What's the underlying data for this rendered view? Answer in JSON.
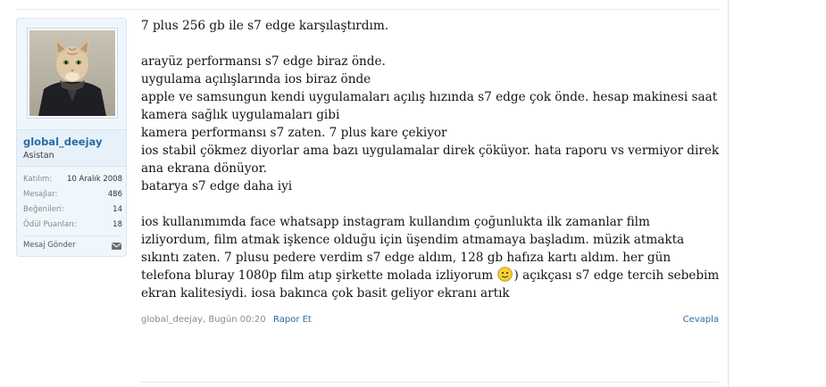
{
  "user": {
    "username": "global_deejay",
    "role": "Asistan",
    "avatar_icon": "cat-in-coat-avatar",
    "stats": [
      {
        "label": "Katılım:",
        "value": "10 Aralık 2008"
      },
      {
        "label": "Mesajlar:",
        "value": "486"
      },
      {
        "label": "Beğenileri:",
        "value": "14"
      },
      {
        "label": "Ödül Puanları:",
        "value": "18"
      }
    ],
    "send_message_label": "Mesaj Gönder",
    "send_message_icon": "envelope-icon"
  },
  "post": {
    "lines": [
      "7 plus 256 gb ile s7 edge karşılaştırdım.",
      "",
      "arayüz performansı s7 edge biraz önde.",
      "uygulama açılışlarında ios biraz önde",
      "apple ve samsungun kendi uygulamaları açılış hızında s7 edge çok önde. hesap makinesi saat kamera sağlık uygulamaları gibi",
      "kamera performansı s7 zaten. 7 plus kare çekiyor",
      "ios stabil çökmez diyorlar ama bazı uygulamalar direk çöküyor. hata raporu vs vermiyor direk ana ekrana dönüyor.",
      "batarya s7 edge daha iyi",
      ""
    ],
    "final_paragraph_before_smiley": "ios kullanımımda face whatsapp instagram kullandım çoğunlukta ilk zamanlar film izliyordum, film atmak işkence olduğu için üşendim atmamaya başladım. müzik atmakta sıkıntı zaten. 7 plusu pedere verdim s7 edge aldım, 128 gb hafıza kartı aldım. her gün telefona bluray 1080p film atıp şirkette molada izliyorum",
    "smiley_icon": "smiley-icon",
    "final_paragraph_after_smiley": ") açıkçası s7 edge tercih sebebim ekran kalitesiydi. iosa bakınca çok basit geliyor ekranı artık",
    "meta": "global_deejay, Bugün 00:20",
    "report_label": "Rapor Et",
    "reply_label": "Cevapla"
  },
  "colors": {
    "link": "#2b6ca3",
    "card_background": "#f0f7fc",
    "border": "#d7e5f2"
  }
}
